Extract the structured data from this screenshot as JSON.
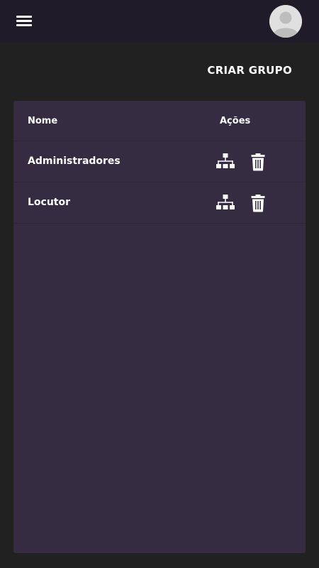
{
  "header": {
    "menu_icon": "menu-icon",
    "avatar_icon": "account-avatar-icon"
  },
  "toolbar": {
    "create_group_label": "CRIAR GRUPO"
  },
  "table": {
    "columns": [
      "Nome",
      "Ações"
    ],
    "rows": [
      {
        "name": "Administradores",
        "actions": [
          "sitemap-icon",
          "trash-icon"
        ]
      },
      {
        "name": "Locutor",
        "actions": [
          "sitemap-icon",
          "trash-icon"
        ]
      }
    ]
  },
  "colors": {
    "background": "#212121",
    "topbar": "#1f1b29",
    "card": "#352c42",
    "text": "#ffffff"
  }
}
